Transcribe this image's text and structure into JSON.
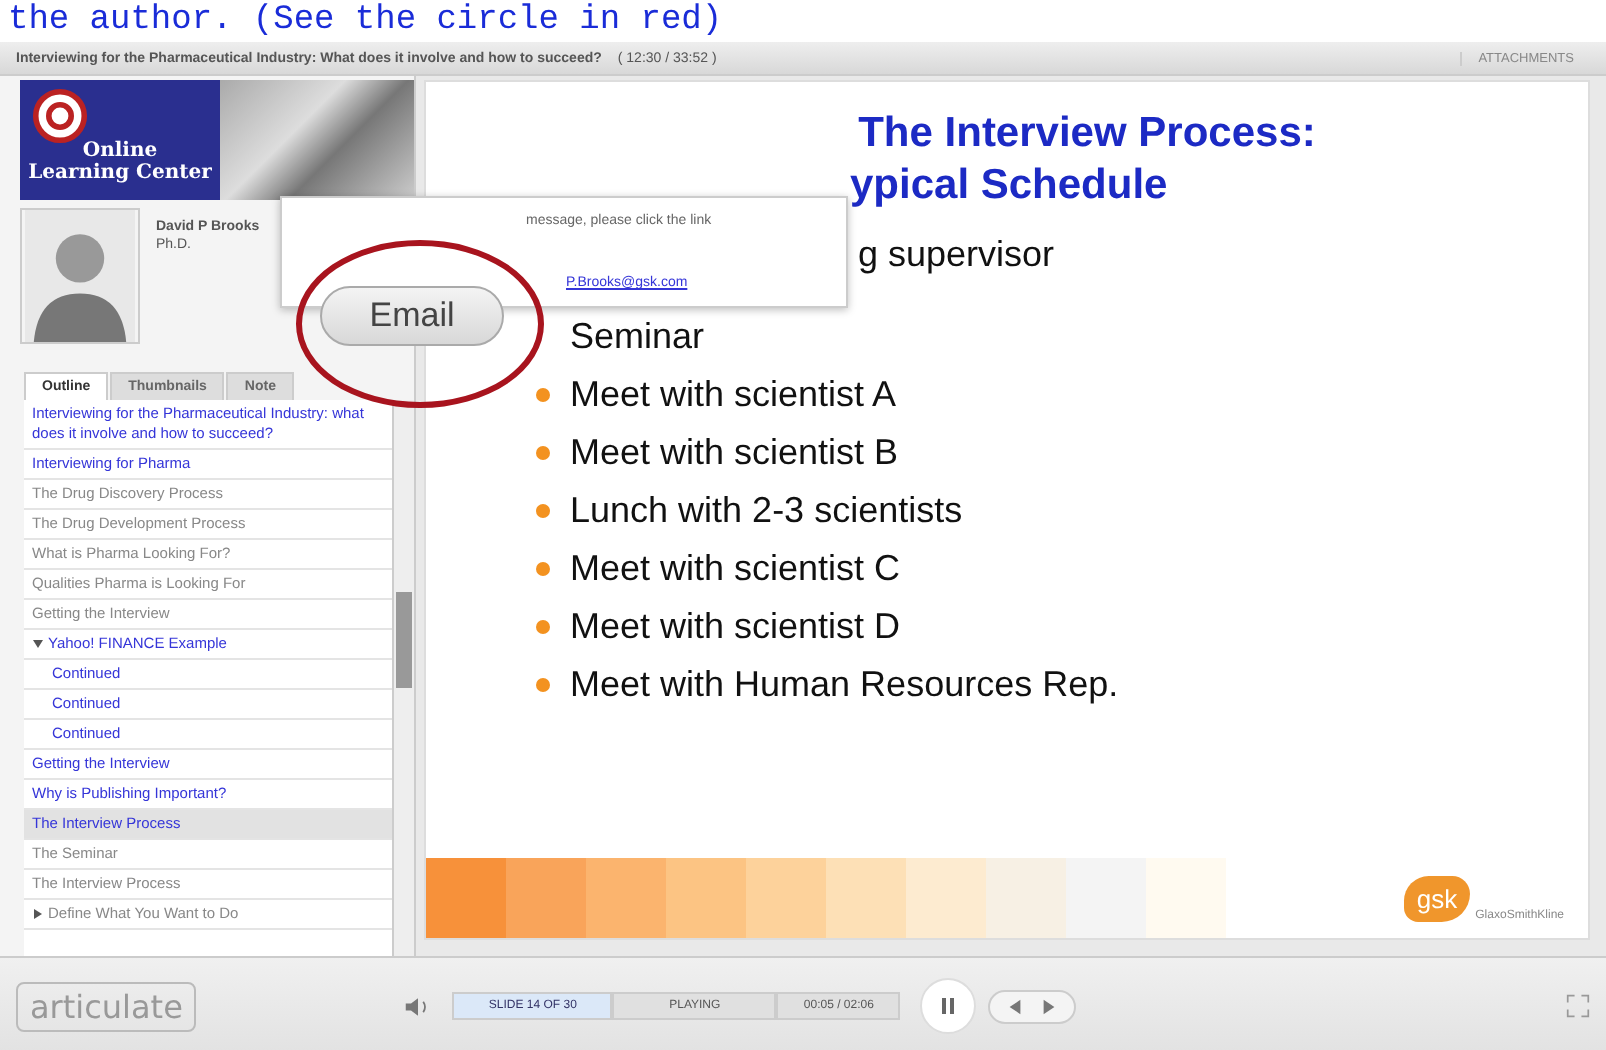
{
  "caption": "the author. (See the circle in red)",
  "header": {
    "title": "Interviewing for the Pharmaceutical Industry: What does it involve and how to succeed?",
    "time": "( 12:30 / 33:52 )",
    "attachments": "ATTACHMENTS"
  },
  "logo": {
    "line1": "Online",
    "line2": "Learning Center"
  },
  "presenter": {
    "name": "David P Brooks",
    "degree": "Ph.D."
  },
  "popup": {
    "message": "message, please click the link",
    "link": "P.Brooks@gsk.com",
    "button": "Email"
  },
  "tabs": [
    {
      "label": "Outline",
      "selected": true
    },
    {
      "label": "Thumbnails",
      "selected": false
    },
    {
      "label": "Note",
      "selected": false
    }
  ],
  "outline": [
    {
      "label": "Interviewing for the Pharmaceutical Industry: what does it involve and how to succeed?",
      "visited": true,
      "selected": false
    },
    {
      "label": "Interviewing for Pharma",
      "visited": true,
      "selected": false
    },
    {
      "label": "The Drug Discovery Process",
      "visited": false,
      "selected": false
    },
    {
      "label": "The Drug Development Process",
      "visited": false,
      "selected": false
    },
    {
      "label": "What is Pharma Looking For?",
      "visited": false,
      "selected": false
    },
    {
      "label": "Qualities Pharma is Looking For",
      "visited": false,
      "selected": false
    },
    {
      "label": "Getting the Interview",
      "visited": false,
      "selected": false
    },
    {
      "label": "Yahoo! FINANCE Example",
      "visited": true,
      "selected": false,
      "expanded": true,
      "children": [
        {
          "label": "Continued",
          "visited": true,
          "selected": false
        },
        {
          "label": "Continued",
          "visited": true,
          "selected": false
        },
        {
          "label": "Continued",
          "visited": true,
          "selected": false
        }
      ]
    },
    {
      "label": "Getting the Interview",
      "visited": true,
      "selected": false
    },
    {
      "label": "Why is Publishing Important?",
      "visited": true,
      "selected": false
    },
    {
      "label": "The Interview Process",
      "visited": true,
      "selected": true
    },
    {
      "label": "The Seminar",
      "visited": false,
      "selected": false
    },
    {
      "label": "The Interview Process",
      "visited": false,
      "selected": false
    },
    {
      "label": "Define What You Want to Do",
      "visited": false,
      "selected": false,
      "expanded": false
    }
  ],
  "slide": {
    "title1": "The Interview Process:",
    "title2": "ypical Schedule",
    "bullets": [
      {
        "text": "g supervisor",
        "bullet": false
      },
      {
        "text": "Seminar",
        "bullet": false
      },
      {
        "text": "Meet with scientist A",
        "bullet": true
      },
      {
        "text": "Meet with scientist B",
        "bullet": true
      },
      {
        "text": "Lunch with 2-3 scientists",
        "bullet": true
      },
      {
        "text": "Meet with scientist C",
        "bullet": true
      },
      {
        "text": "Meet with scientist D",
        "bullet": true
      },
      {
        "text": "Meet with Human Resources Rep.",
        "bullet": true
      }
    ],
    "brand": "gsk",
    "brand_name": "GlaxoSmithKline"
  },
  "footer": {
    "logo": "articulate",
    "slide": "SLIDE 14 OF 30",
    "status": "PLAYING",
    "time": "00:05 / 02:06"
  }
}
